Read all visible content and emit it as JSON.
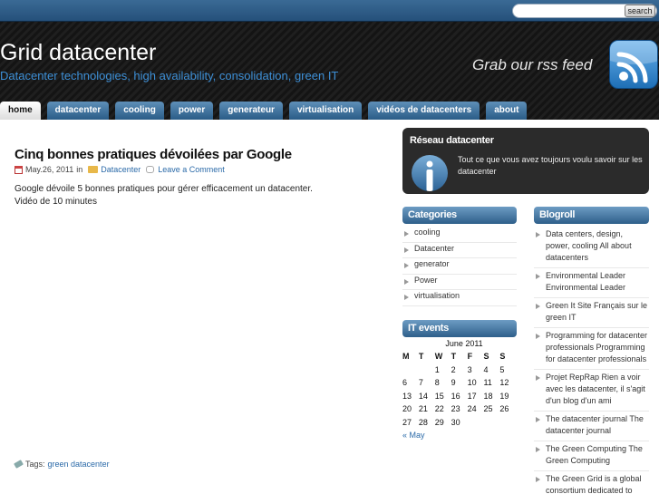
{
  "search": {
    "button_label": "search",
    "placeholder": ""
  },
  "header": {
    "title": "Grid datacenter",
    "description": "Datacenter technologies, high availability, consolidation, green IT",
    "rss_text": "Grab our rss feed",
    "rss_icon": "rss-icon"
  },
  "nav": {
    "tabs": [
      {
        "label": "home",
        "active": true
      },
      {
        "label": "datacenter"
      },
      {
        "label": "cooling"
      },
      {
        "label": "power"
      },
      {
        "label": "generateur"
      },
      {
        "label": "virtualisation"
      },
      {
        "label": "vidéos de datacenters"
      },
      {
        "label": "about"
      }
    ]
  },
  "post": {
    "title": "Cinq bonnes pratiques dévoilées par Google",
    "date": "May.26, 2011",
    "in_word": "in",
    "category": "Datacenter",
    "comment_link": "Leave a Comment",
    "body_line1": "Google dévoile 5 bonnes pratiques pour gérer efficacement un datacenter.",
    "body_line2": "Vidéo de 10 minutes",
    "tags_label": "Tags:",
    "tags": "green datacenter"
  },
  "network": {
    "title": "Réseau datacenter",
    "text": "Tout ce que vous avez toujours voulu savoir sur les datacenter"
  },
  "categories": {
    "title": "Categories",
    "items": [
      "cooling",
      "Datacenter",
      "generator",
      "Power",
      "virtualisation"
    ]
  },
  "events": {
    "title": "IT events",
    "calendar": {
      "caption": "June 2011",
      "days": [
        "M",
        "T",
        "W",
        "T",
        "F",
        "S",
        "S"
      ],
      "weeks": [
        [
          "",
          "",
          "1",
          "2",
          "3",
          "4",
          "5"
        ],
        [
          "6",
          "7",
          "8",
          "9",
          "10",
          "11",
          "12"
        ],
        [
          "13",
          "14",
          "15",
          "16",
          "17",
          "18",
          "19"
        ],
        [
          "20",
          "21",
          "22",
          "23",
          "24",
          "25",
          "26"
        ],
        [
          "27",
          "28",
          "29",
          "30",
          "",
          "",
          ""
        ]
      ],
      "prev_link": "« May"
    }
  },
  "blogroll": {
    "title": "Blogroll",
    "items": [
      "Data centers, design, power, cooling All about datacenters",
      "Environmental Leader Environmental Leader",
      "Green It Site Français sur le green IT",
      "Programming for datacenter professionals Programming for datacenter professionals",
      "Projet RepRap Rien a voir avec les datacenter, il s'agit d'un blog d'un ami",
      "The datacenter journal The datacenter journal",
      "The Green Computing The Green Computing",
      "The Green Grid is a global consortium dedicated to"
    ]
  }
}
